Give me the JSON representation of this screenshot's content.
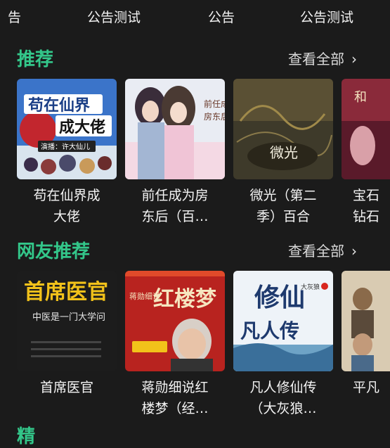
{
  "ticker": [
    "告",
    "公告测试",
    "公告",
    "公告测试"
  ],
  "sections": [
    {
      "title": "推荐",
      "view_all": "查看全部",
      "items": [
        {
          "title_line1": "苟在仙界成",
          "title_line2": "大佬",
          "cover_text_main": "苟在仙界",
          "cover_text_sub": "成大佬",
          "cover_text_small": "演播：许大仙儿"
        },
        {
          "title_line1": "前任成为房",
          "title_line2": "东后（百…",
          "cover_text_main": "前任成为",
          "cover_text_sub": "房东后"
        },
        {
          "title_line1": "微光（第二",
          "title_line2": "季）百合",
          "cover_text_main": "微光"
        },
        {
          "title_line1": "宝石",
          "title_line2": "钻石",
          "cover_text_main": "和"
        }
      ]
    },
    {
      "title": "网友推荐",
      "view_all": "查看全部",
      "items": [
        {
          "title_line1": "首席医官",
          "title_line2": "",
          "cover_text_main": "首席医官",
          "cover_text_sub": "中医是一门大学问"
        },
        {
          "title_line1": "蒋勋细说红",
          "title_line2": "楼梦（经…",
          "cover_text_main": "红楼梦",
          "cover_text_sub": "蒋勋细说"
        },
        {
          "title_line1": "凡人修仙传",
          "title_line2": "（大灰狼…",
          "cover_text_main": "修仙",
          "cover_text_sub": "凡人传",
          "cover_text_small": "大灰狼"
        },
        {
          "title_line1": "平凡",
          "title_line2": "",
          "cover_text_main": ""
        }
      ]
    }
  ],
  "next_section_partial": "精",
  "colors": {
    "accent": "#33c78a",
    "background": "#1b1b1b"
  },
  "icons": {
    "chevron": "chevron-right-icon"
  }
}
